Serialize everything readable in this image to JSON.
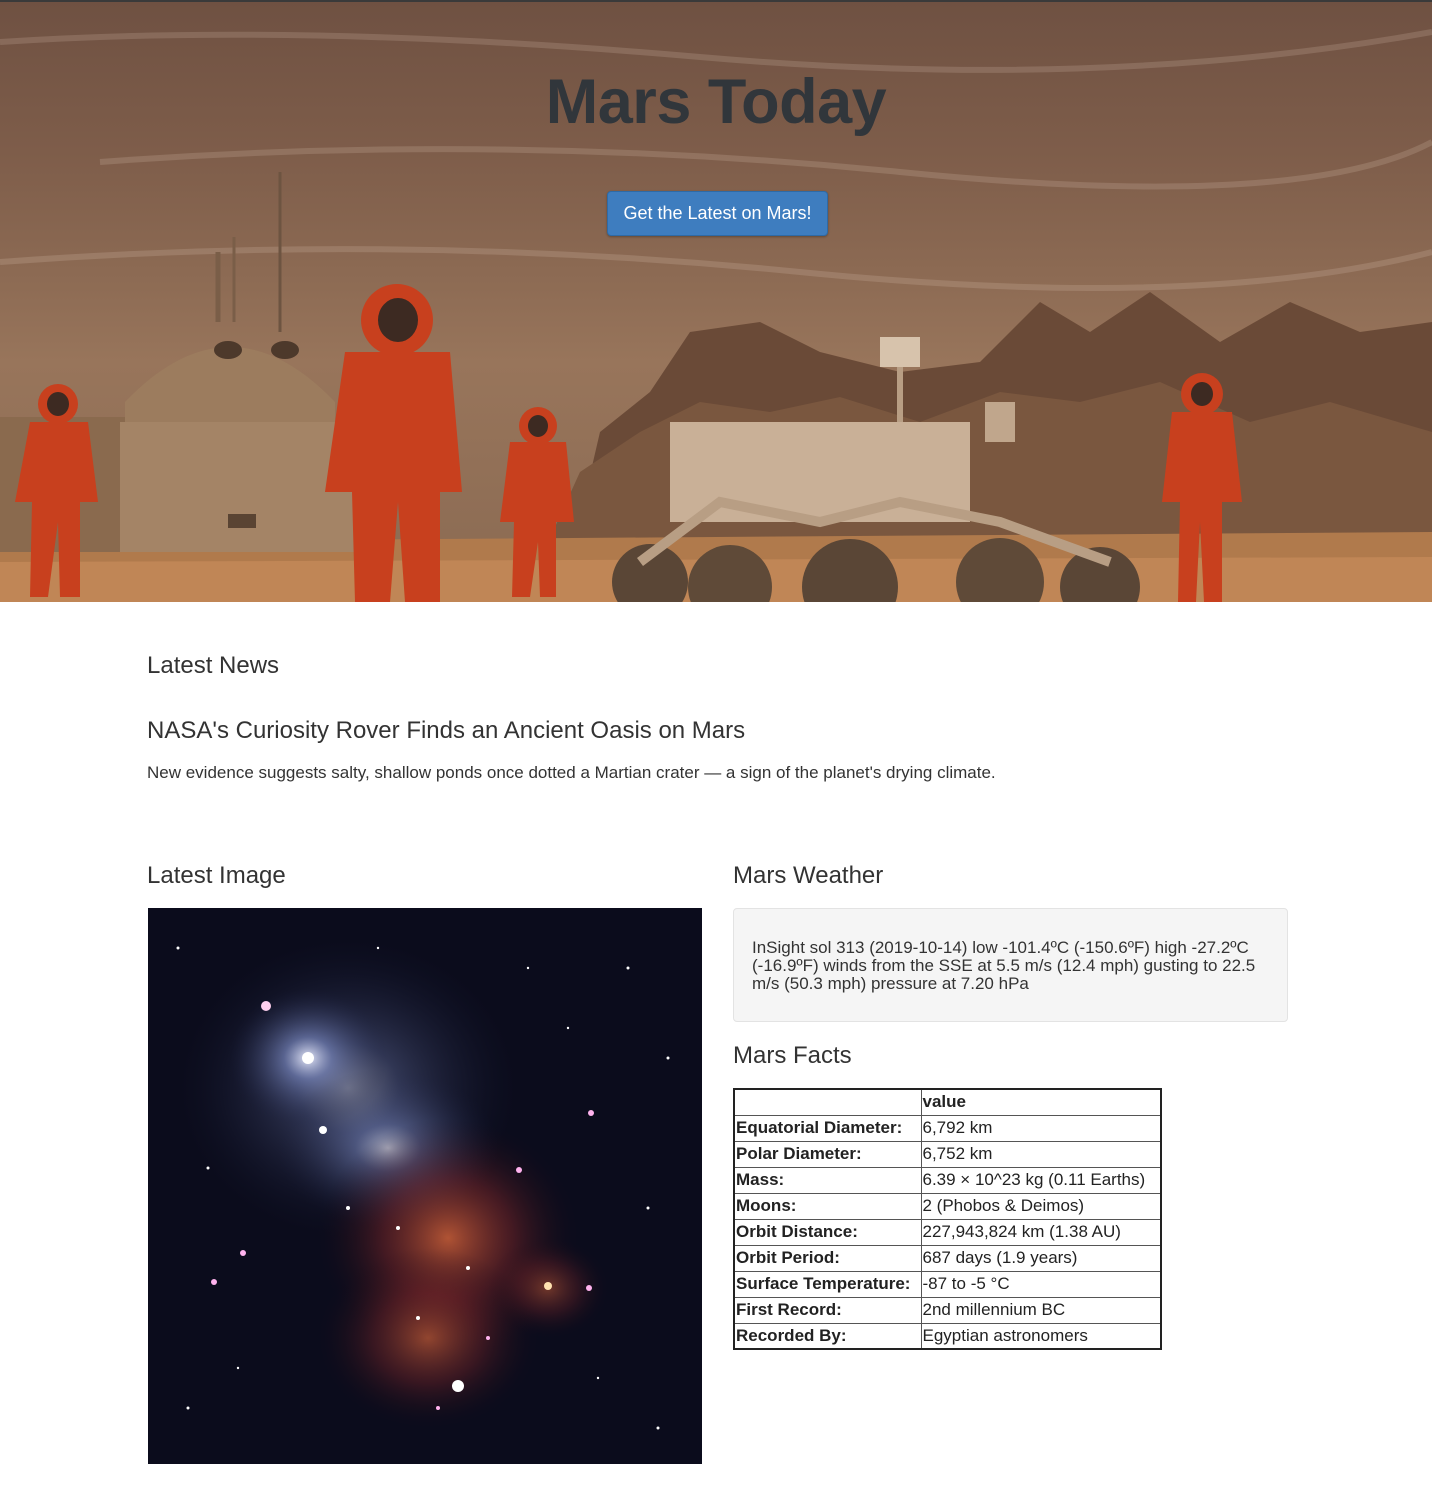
{
  "hero": {
    "title": "Mars Today",
    "button_label": "Get the Latest on Mars!"
  },
  "news": {
    "heading": "Latest News",
    "title": "NASA's Curiosity Rover Finds an Ancient Oasis on Mars",
    "teaser": "New evidence suggests salty, shallow ponds once dotted a Martian crater — a sign of the planet's drying climate."
  },
  "image_section": {
    "heading": "Latest Image"
  },
  "weather": {
    "heading": "Mars Weather",
    "text": "InSight sol 313 (2019-10-14) low -101.4ºC (-150.6ºF) high -27.2ºC (-16.9ºF) winds from the SSE at 5.5 m/s (12.4 mph) gusting to 22.5 m/s (50.3 mph) pressure at 7.20 hPa"
  },
  "facts": {
    "heading": "Mars Facts",
    "columns": [
      "",
      "value"
    ],
    "rows": [
      {
        "label": "Equatorial Diameter:",
        "value": "6,792 km"
      },
      {
        "label": "Polar Diameter:",
        "value": "6,752 km"
      },
      {
        "label": "Mass:",
        "value": "6.39 × 10^23 kg (0.11 Earths)"
      },
      {
        "label": "Moons:",
        "value": "2 (Phobos & Deimos)"
      },
      {
        "label": "Orbit Distance:",
        "value": "227,943,824 km (1.38 AU)"
      },
      {
        "label": "Orbit Period:",
        "value": "687 days (1.9 years)"
      },
      {
        "label": "Surface Temperature:",
        "value": "-87 to -5 °C"
      },
      {
        "label": "First Record:",
        "value": "2nd millennium BC"
      },
      {
        "label": "Recorded By:",
        "value": "Egyptian astronomers"
      }
    ]
  },
  "colors": {
    "button": "#3e7dbf",
    "title": "#31363b",
    "mars_sky": "#8c6a53",
    "suit": "#c8401e"
  }
}
